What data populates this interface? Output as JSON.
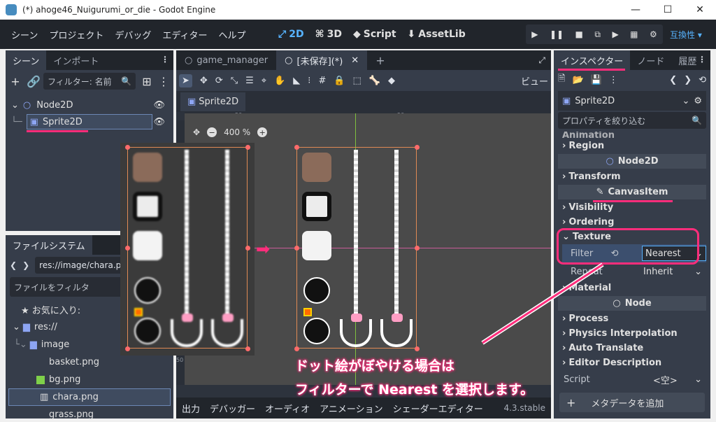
{
  "window": {
    "title": "(*) ahoge46_Nuigurumi_or_die - Godot Engine",
    "minimize": "—",
    "maximize": "☐",
    "close": "✕"
  },
  "menu": [
    "シーン",
    "プロジェクト",
    "デバッグ",
    "エディター",
    "ヘルプ"
  ],
  "main_screens": [
    "2D",
    "3D",
    "Script",
    "AssetLib"
  ],
  "main_screen_icons": [
    "⤢",
    "⌘",
    "◆",
    "⬇"
  ],
  "play_buttons": [
    "▶",
    "❚❚",
    "■",
    "⧉",
    "▶",
    "▦",
    "⚙"
  ],
  "renderer": "互換性 ▾",
  "scene_dock": {
    "tabs": [
      "シーン",
      "インポート"
    ],
    "filter_placeholder": "フィルター: 名前",
    "nodes": [
      {
        "name": "Node2D",
        "icon": "circle-icon"
      },
      {
        "name": "Sprite2D",
        "icon": "sprite-icon"
      }
    ]
  },
  "filesystem_dock": {
    "tab": "ファイルシステム",
    "path": "res://image/chara.png",
    "filter_placeholder": "ファイルをフィルタ",
    "items": [
      {
        "label": "★ お気に入り:",
        "indent": 0
      },
      {
        "label": "res://",
        "indent": 1
      },
      {
        "label": "image",
        "indent": 2
      },
      {
        "label": "basket.png",
        "indent": 3
      },
      {
        "label": "bg.png",
        "indent": 3
      },
      {
        "label": "chara.png",
        "indent": 3
      },
      {
        "label": "grass.png",
        "indent": 3
      }
    ]
  },
  "editor": {
    "tabs": [
      {
        "label": "game_manager",
        "active": false
      },
      {
        "label": "[未保存](*)",
        "active": true
      }
    ],
    "add_tab": "+",
    "view_menu": "ビュー",
    "toolbar_icons": [
      "➤",
      "✥",
      "⟳",
      "⤡",
      "☰",
      "⌖",
      "✋",
      "◣",
      "⁝",
      "#",
      "🔒",
      "⬚",
      "🦴",
      "◆"
    ],
    "scene_tab": "Sprite2D",
    "zoom": "400 %",
    "zoom_out": "−",
    "zoom_in": "+",
    "ruler_marks": [
      "50",
      "50",
      "50",
      "50",
      "50"
    ],
    "arrow": "➡",
    "bottom_tabs": [
      "出力",
      "デバッガー",
      "オーディオ",
      "アニメーション",
      "シェーダーエディター"
    ],
    "version": "4.3.stable"
  },
  "inspector": {
    "tabs": [
      "インスペクター",
      "ノード",
      "履歴"
    ],
    "object": "Sprite2D",
    "filter_placeholder": "プロパティを絞り込む",
    "sections": [
      "Animation",
      "Region"
    ],
    "class_node2d": "Node2D",
    "transform": "Transform",
    "class_canvasitem": "CanvasItem",
    "sections2": [
      "Visibility",
      "Ordering"
    ],
    "texture": "Texture",
    "filter_label": "Filter",
    "filter_value": "Nearest",
    "repeat_label": "Repeat",
    "repeat_value": "Inherit",
    "material": "Material",
    "class_node": "Node",
    "sections3": [
      "Process",
      "Physics Interpolation",
      "Auto Translate",
      "Editor Description"
    ],
    "script_label": "Script",
    "script_value": "<空>",
    "add_metadata": "メタデータを追加"
  },
  "annotation": {
    "line1": "ドット絵がぼやける場合は",
    "line2": "フィルターで Nearest を選択します。",
    "color": "#ff2d7b"
  }
}
